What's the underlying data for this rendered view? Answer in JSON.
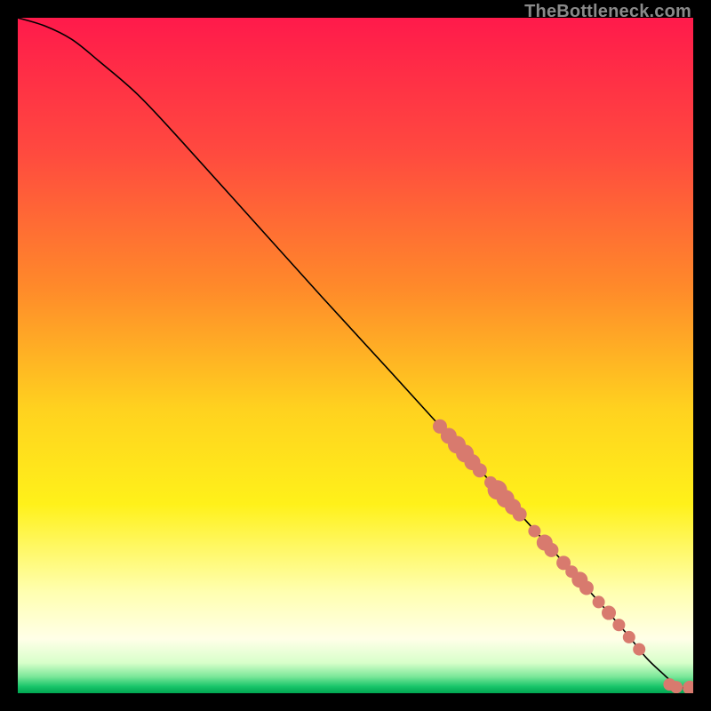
{
  "watermark": "TheBottleneck.com",
  "chart_data": {
    "type": "line",
    "title": "",
    "xlabel": "",
    "ylabel": "",
    "xlim": [
      0,
      100
    ],
    "ylim": [
      0,
      100
    ],
    "grid": false,
    "legend": false,
    "background_gradient": {
      "stops": [
        {
          "offset": 0.0,
          "color": "#ff1a4b"
        },
        {
          "offset": 0.2,
          "color": "#ff4a3f"
        },
        {
          "offset": 0.4,
          "color": "#ff8a2a"
        },
        {
          "offset": 0.58,
          "color": "#ffd21f"
        },
        {
          "offset": 0.72,
          "color": "#fff11a"
        },
        {
          "offset": 0.85,
          "color": "#ffffb0"
        },
        {
          "offset": 0.92,
          "color": "#ffffe8"
        },
        {
          "offset": 0.955,
          "color": "#d8ffca"
        },
        {
          "offset": 0.975,
          "color": "#7de89a"
        },
        {
          "offset": 0.99,
          "color": "#18c56a"
        },
        {
          "offset": 1.0,
          "color": "#00a651"
        }
      ]
    },
    "series": [
      {
        "name": "curve",
        "color": "#000000",
        "x": [
          0,
          4,
          8,
          12,
          18,
          25,
          35,
          45,
          55,
          65,
          75,
          85,
          90,
          93,
          95.5,
          97,
          98.5,
          100
        ],
        "y": [
          100,
          98.8,
          96.8,
          93.6,
          88.4,
          80.9,
          69.8,
          58.7,
          47.8,
          36.8,
          25.8,
          14.7,
          9.0,
          5.3,
          2.9,
          1.6,
          0.8,
          0.8
        ]
      }
    ],
    "markers": {
      "name": "points",
      "color": "#d87a6e",
      "radius_range": [
        6,
        11
      ],
      "points": [
        {
          "x": 62.5,
          "y": 39.5,
          "r": 8
        },
        {
          "x": 63.8,
          "y": 38.1,
          "r": 9
        },
        {
          "x": 65.0,
          "y": 36.8,
          "r": 10
        },
        {
          "x": 66.2,
          "y": 35.5,
          "r": 10
        },
        {
          "x": 67.3,
          "y": 34.2,
          "r": 9
        },
        {
          "x": 68.4,
          "y": 33.0,
          "r": 8
        },
        {
          "x": 70.0,
          "y": 31.2,
          "r": 7
        },
        {
          "x": 71.0,
          "y": 30.1,
          "r": 11
        },
        {
          "x": 72.2,
          "y": 28.8,
          "r": 10
        },
        {
          "x": 73.3,
          "y": 27.6,
          "r": 9
        },
        {
          "x": 74.3,
          "y": 26.5,
          "r": 8
        },
        {
          "x": 76.5,
          "y": 24.0,
          "r": 7
        },
        {
          "x": 78.0,
          "y": 22.3,
          "r": 9
        },
        {
          "x": 79.0,
          "y": 21.2,
          "r": 8
        },
        {
          "x": 80.8,
          "y": 19.3,
          "r": 8
        },
        {
          "x": 82.0,
          "y": 18.0,
          "r": 7
        },
        {
          "x": 83.2,
          "y": 16.8,
          "r": 9
        },
        {
          "x": 84.2,
          "y": 15.6,
          "r": 8
        },
        {
          "x": 86.0,
          "y": 13.5,
          "r": 7
        },
        {
          "x": 87.5,
          "y": 11.9,
          "r": 8
        },
        {
          "x": 89.0,
          "y": 10.1,
          "r": 7
        },
        {
          "x": 90.5,
          "y": 8.3,
          "r": 7
        },
        {
          "x": 92.0,
          "y": 6.5,
          "r": 7
        },
        {
          "x": 96.5,
          "y": 1.3,
          "r": 7
        },
        {
          "x": 97.5,
          "y": 0.9,
          "r": 7
        },
        {
          "x": 99.5,
          "y": 0.8,
          "r": 8
        },
        {
          "x": 100.0,
          "y": 0.8,
          "r": 7
        }
      ]
    }
  }
}
